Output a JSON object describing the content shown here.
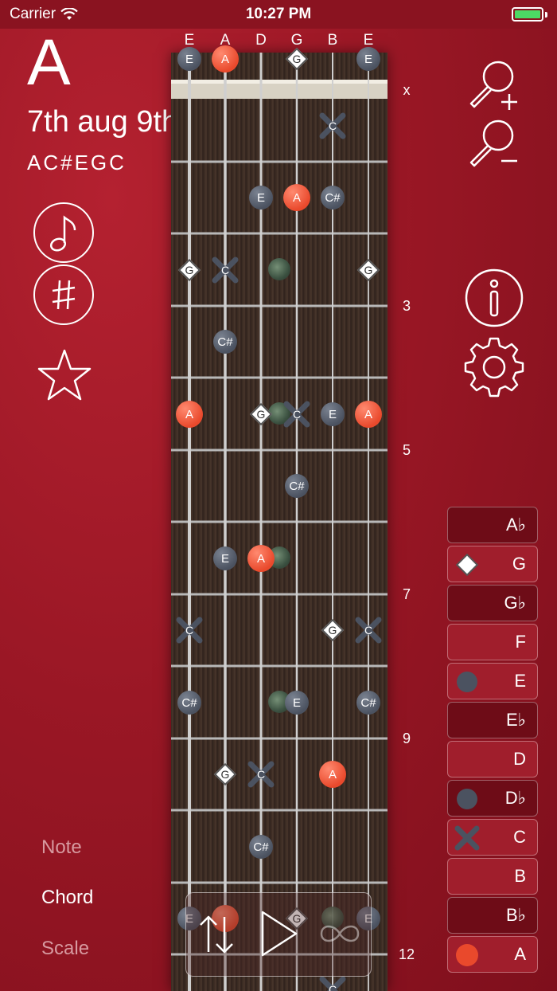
{
  "status_bar": {
    "carrier": "Carrier",
    "time": "10:27 PM",
    "battery_level": 1.0
  },
  "chord": {
    "root": "A",
    "name": "7th aug 9th",
    "notes": "AC#EGC"
  },
  "strings": [
    "E",
    "A",
    "D",
    "G",
    "B",
    "E"
  ],
  "fret_numbers": {
    "open_marker": "x",
    "f3": "3",
    "f5": "5",
    "f7": "7",
    "f9": "9",
    "f12": "12"
  },
  "markers": {
    "m1": "E",
    "m2": "A",
    "m3": "G",
    "m4": "E",
    "m5": "C",
    "m6": "E",
    "m7": "A",
    "m8": "C#",
    "m9": "G",
    "m10": "C",
    "m11": "G",
    "m12": "C#",
    "m13": "A",
    "m14": "G",
    "m15": "C",
    "m16": "E",
    "m17": "A",
    "m18": "C#",
    "m19": "E",
    "m20": "A",
    "m21": "C",
    "m22": "G",
    "m23": "C",
    "m24": "C#",
    "m25": "E",
    "m26": "C#",
    "m27": "G",
    "m28": "C",
    "m29": "A",
    "m30": "C#",
    "m31": "E",
    "m32": "G",
    "m33": "E",
    "m34": "C"
  },
  "modes": {
    "note": "Note",
    "chord": "Chord",
    "scale": "Scale"
  },
  "note_list": [
    {
      "label": "A♭",
      "symbol": "none"
    },
    {
      "label": "G",
      "symbol": "diamond"
    },
    {
      "label": "G♭",
      "symbol": "none"
    },
    {
      "label": "F",
      "symbol": "none"
    },
    {
      "label": "E",
      "symbol": "dot"
    },
    {
      "label": "E♭",
      "symbol": "none"
    },
    {
      "label": "D",
      "symbol": "none"
    },
    {
      "label": "D♭",
      "symbol": "dot"
    },
    {
      "label": "C",
      "symbol": "cross"
    },
    {
      "label": "B",
      "symbol": "none"
    },
    {
      "label": "B♭",
      "symbol": "none"
    },
    {
      "label": "A",
      "symbol": "root"
    }
  ],
  "icons": {
    "zoom_in": "zoom-in-icon",
    "zoom_out": "zoom-out-icon",
    "info": "info-icon",
    "settings": "gear-icon",
    "note_toggle": "music-note-icon",
    "sharp_toggle": "sharp-icon",
    "favorite": "star-icon",
    "flip": "flip-arrows-icon",
    "play": "play-icon",
    "loop": "loop-icon"
  },
  "colors": {
    "background": "#9a1725",
    "root_note": "#e9492c",
    "note_dot": "#4b5260",
    "fretboard": "#3a2a22"
  }
}
